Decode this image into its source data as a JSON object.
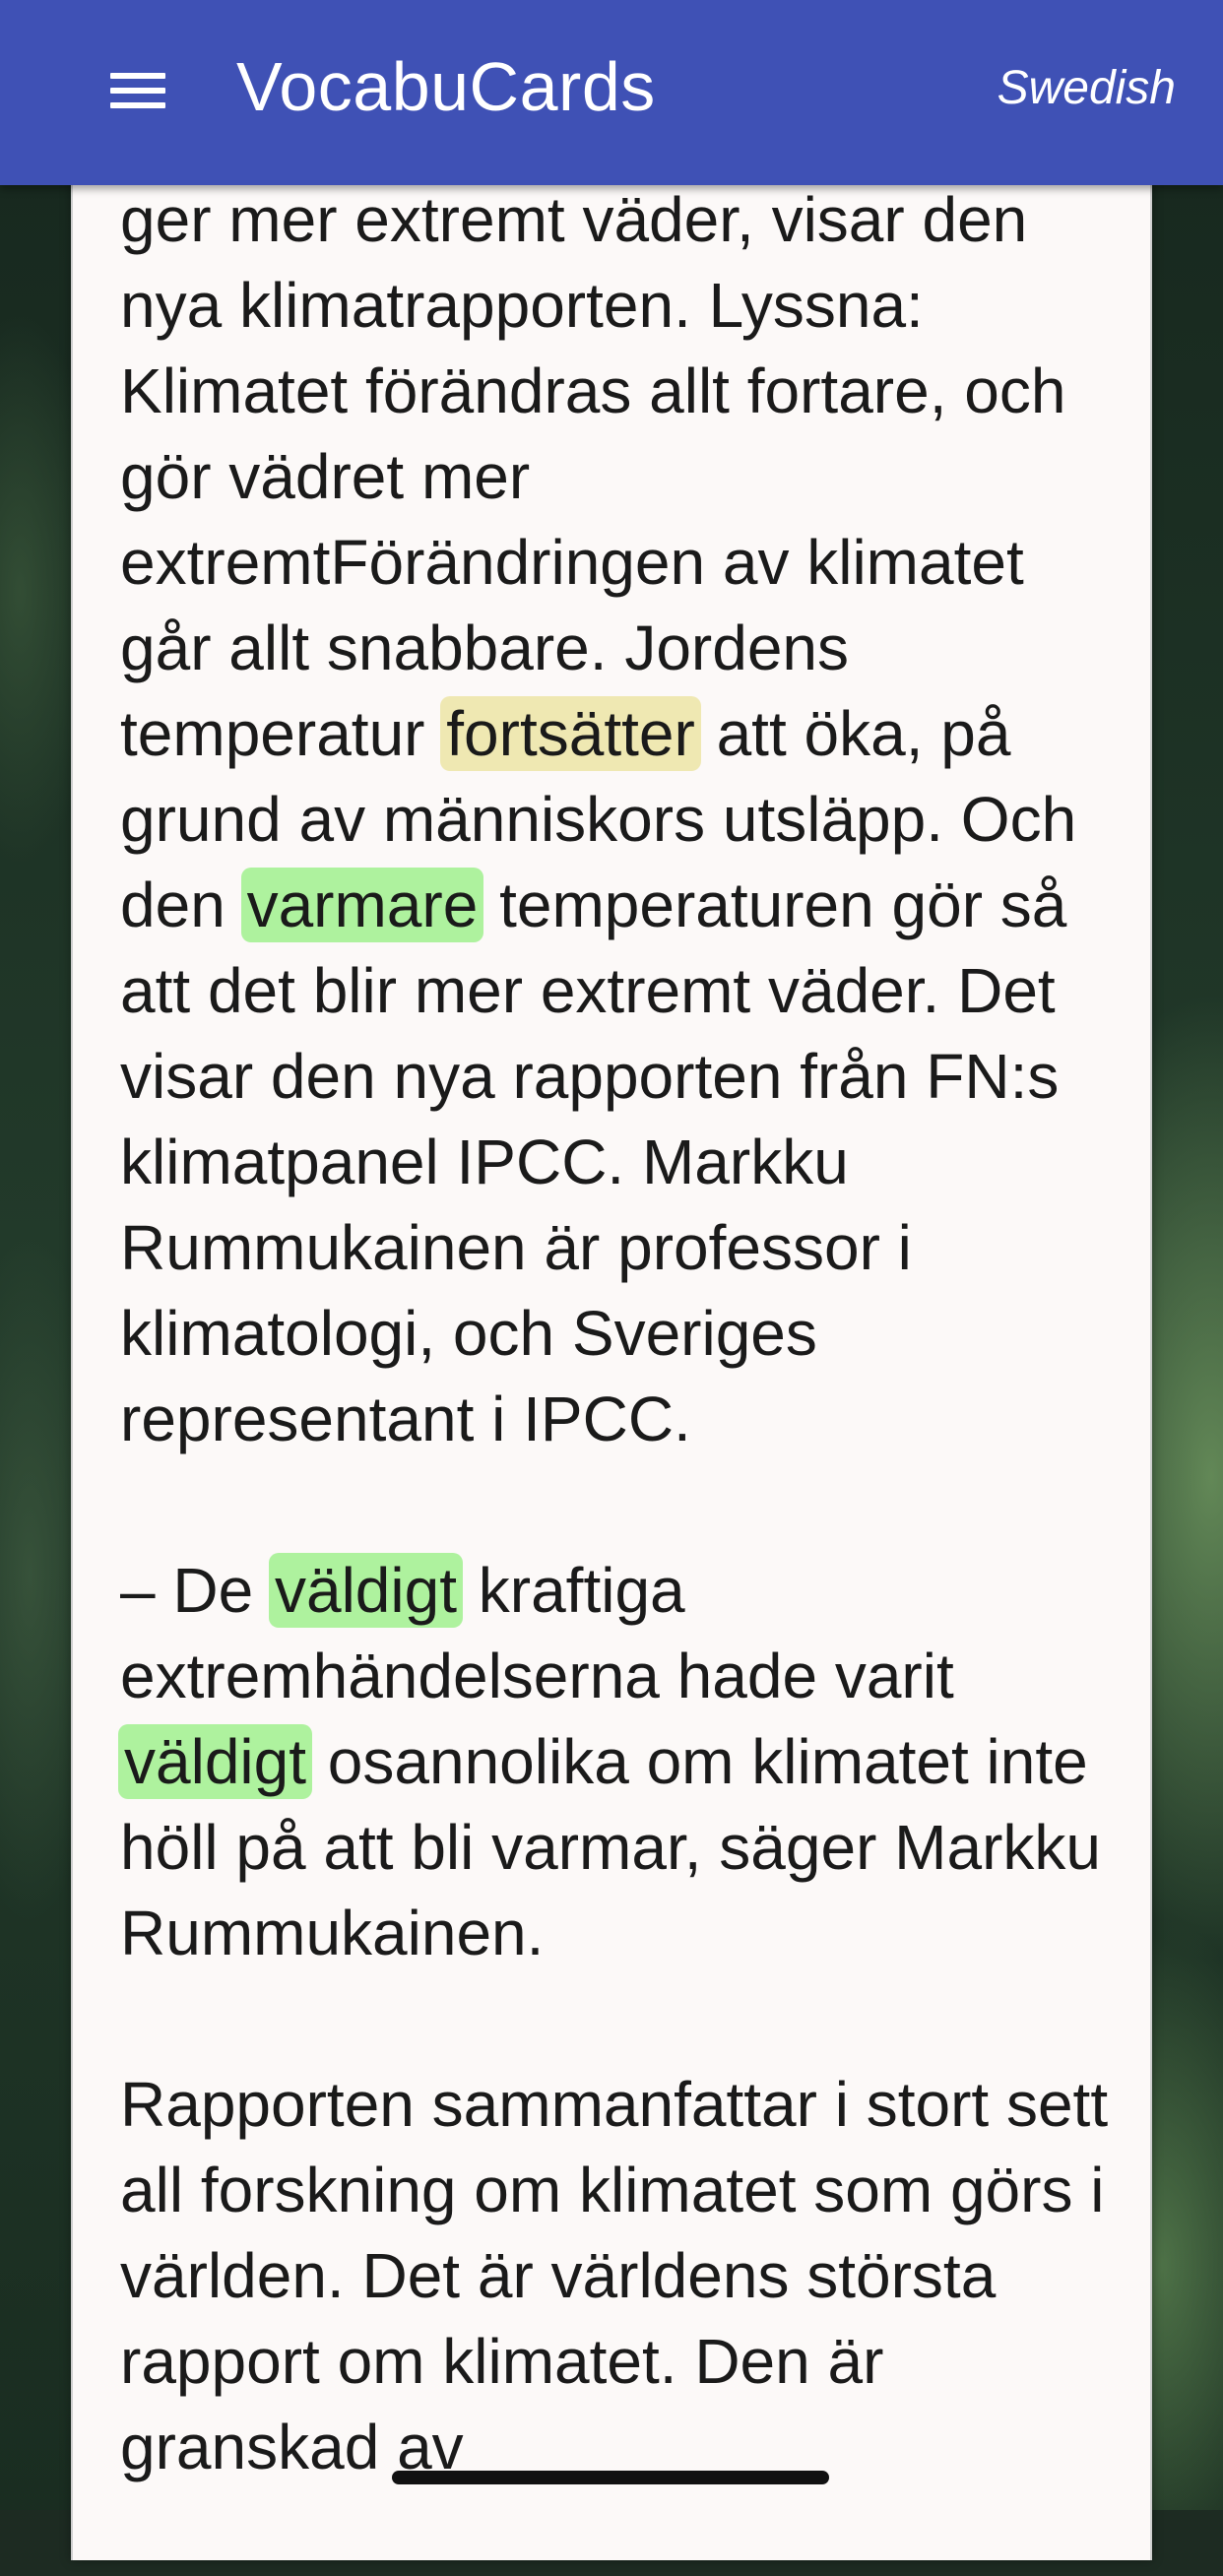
{
  "appbar": {
    "title": "VocabuCards",
    "language": "Swedish",
    "menu_icon": "hamburger-menu-icon"
  },
  "article": {
    "p1": {
      "t1": " ger mer extremt väder, visar den nya klimatrapporten. Lyssna: Klimatet förändras allt fortare, och gör vädret mer extremtFörändringen av klimatet går allt snabbare. Jordens temperatur ",
      "w1": "fortsätter",
      "t2": " att öka, på grund av människors utsläpp. Och den ",
      "w2": "varmare",
      "t3": " temperaturen gör så att det blir mer extremt väder. Det visar den nya rapporten från FN:s klimatpanel IPCC. Markku Rummukainen är professor i klimatologi, och Sveriges representant i IPCC."
    },
    "p2": {
      "t1": "– De ",
      "w1": "väldigt",
      "t2": " kraftiga extremhändelserna hade varit ",
      "w2": "väldigt",
      "t3": " osannolika om klimatet inte höll på att bli varmar, säger Markku Rummukainen."
    },
    "p3": {
      "t1": "Rapporten sammanfattar i stort sett all forskning om klimatet som görs i världen. Det  är världens största rapport om klimatet. Den är granskad av"
    }
  },
  "colors": {
    "appbar": "#3f51b5",
    "highlight_learning": "#efe8b2",
    "highlight_known": "#aef29e"
  }
}
